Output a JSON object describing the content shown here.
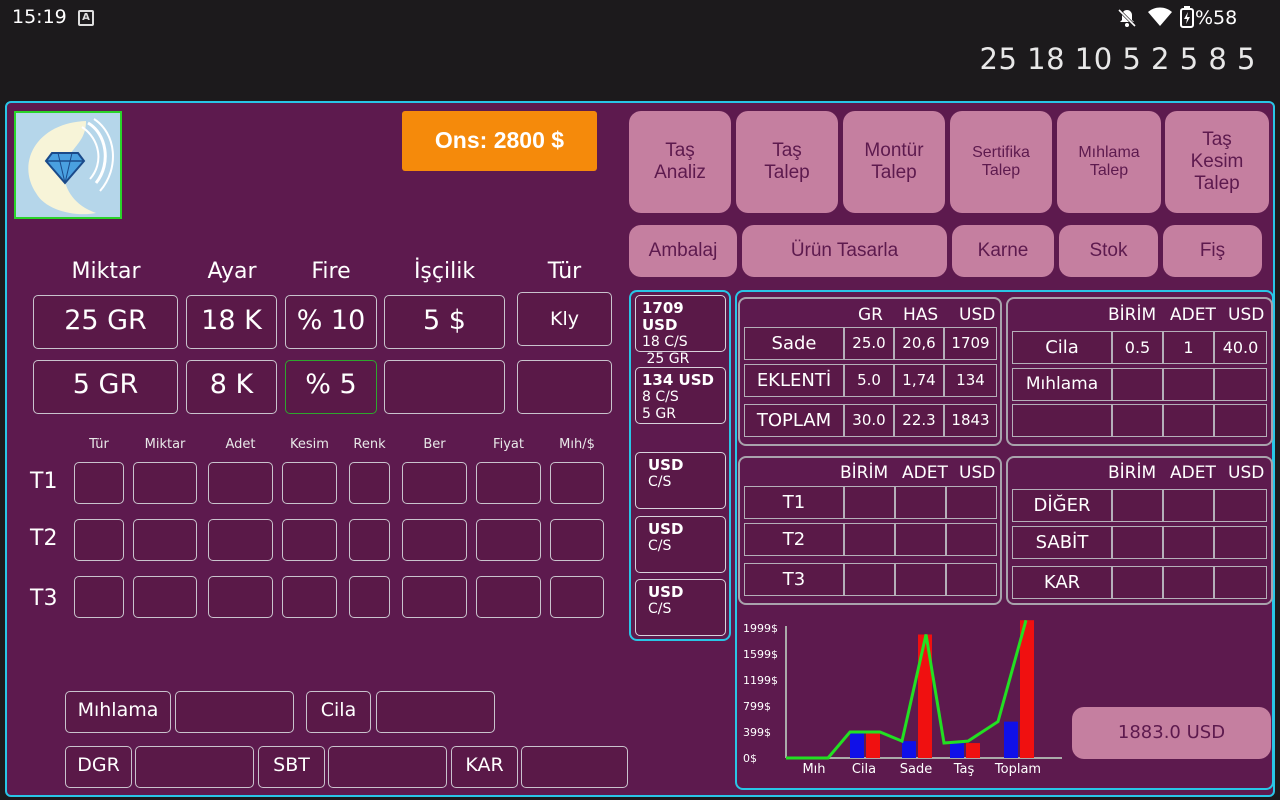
{
  "status": {
    "time": "15:19",
    "notif_icon": "A",
    "battery": "%58"
  },
  "top_numbers": "25 18 10 5 2 5 8 5",
  "ons": "Ons: 2800 $",
  "headers": {
    "miktar": "Miktar",
    "ayar": "Ayar",
    "fire": "Fire",
    "iscilik": "İşçilik",
    "tur": "Tür"
  },
  "row1": {
    "miktar": "25 GR",
    "ayar": "18 K",
    "fire": "% 10",
    "iscilik": "5 $",
    "tur": "Kly"
  },
  "row2": {
    "miktar": "5 GR",
    "ayar": "8 K",
    "fire": "% 5",
    "iscilik": "",
    "tur": ""
  },
  "stone_cols": [
    "Tür",
    "Miktar",
    "Adet",
    "Kesim",
    "Renk",
    "Ber",
    "Fiyat",
    "Mıh/$"
  ],
  "stone_rows": [
    "T1",
    "T2",
    "T3"
  ],
  "bottom": {
    "mihlama": "Mıhlama",
    "cila": "Cila",
    "dgr": "DGR",
    "sbt": "SBT",
    "kar": "KAR"
  },
  "menu_row1": [
    "Taş\nAnaliz",
    "Taş\nTalep",
    "Montür\nTalep",
    "Sertifika\nTalep",
    "Mıhlama\nTalep",
    "Taş\nKesim\nTalep"
  ],
  "menu_row2": [
    "Ambalaj",
    "Ürün Tasarla",
    "Karne",
    "Stok",
    "Fiş"
  ],
  "usd_cards": [
    {
      "l1": "1709 USD",
      "l2": "18 C/S",
      "l3": " 25 GR"
    },
    {
      "l1": "134 USD",
      "l2": "8 C/S",
      "l3": "5 GR"
    },
    {
      "l1": "USD",
      "l2": "C/S",
      "l3": ""
    },
    {
      "l1": "USD",
      "l2": "C/S",
      "l3": ""
    },
    {
      "l1": "USD",
      "l2": "C/S",
      "l3": ""
    }
  ],
  "summary": {
    "headers": [
      "GR",
      "HAS",
      "USD"
    ],
    "rows": [
      {
        "label": "Sade",
        "gr": "25.0",
        "has": "20,6",
        "usd": "1709"
      },
      {
        "label": "EKLENTİ",
        "gr": "5.0",
        "has": "1,74",
        "usd": "134"
      },
      {
        "label": "TOPLAM",
        "gr": "30.0",
        "has": "22.3",
        "usd": "1843"
      }
    ]
  },
  "cila_table": {
    "headers": [
      "BİRİM",
      "ADET",
      "USD"
    ],
    "rows": [
      {
        "label": "Cila",
        "birim": "0.5",
        "adet": "1",
        "usd": "40.0"
      },
      {
        "label": "Mıhlama",
        "birim": "",
        "adet": "",
        "usd": ""
      },
      {
        "label": "",
        "birim": "",
        "adet": "",
        "usd": ""
      }
    ]
  },
  "t_table": {
    "headers": [
      "BİRİM",
      "ADET",
      "USD"
    ],
    "rows": [
      "T1",
      "T2",
      "T3"
    ]
  },
  "other_table": {
    "headers": [
      "BİRİM",
      "ADET",
      "USD"
    ],
    "rows": [
      "DİĞER",
      "SABİT",
      "KAR"
    ]
  },
  "total_usd": "1883.0 USD",
  "chart_data": {
    "type": "bar",
    "categories": [
      "Mıh",
      "Cila",
      "Sade",
      "Taş",
      "Toplam"
    ],
    "y_ticks": [
      "1999$",
      "1599$",
      "1199$",
      "799$",
      "399$",
      "0$"
    ],
    "ylim": [
      0,
      2000
    ],
    "series": [
      {
        "color": "#1010e8",
        "values": [
          0,
          400,
          260,
          230,
          560
        ]
      },
      {
        "color": "#f01010",
        "values": [
          0,
          400,
          1900,
          230,
          2150
        ]
      }
    ],
    "line": {
      "color": "#22e022",
      "values": [
        0,
        0,
        400,
        400,
        260,
        1900,
        230,
        260,
        560,
        2150
      ]
    }
  }
}
